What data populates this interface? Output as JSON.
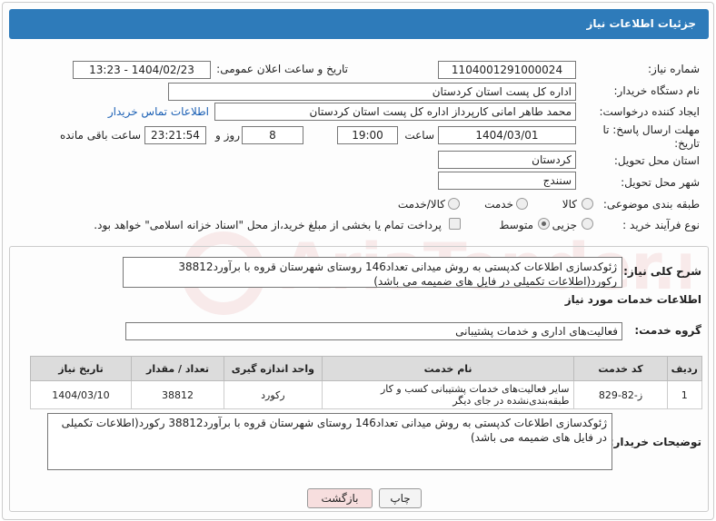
{
  "header": {
    "title": "جزئیات اطلاعات نیاز"
  },
  "labels": {
    "need_number": "شماره نیاز:",
    "announce_datetime": "تاریخ و ساعت اعلان عمومی:",
    "buyer_org": "نام دستگاه خریدار:",
    "requester": "ایجاد کننده درخواست:",
    "contact_link": "اطلاعات تماس خریدار",
    "deadline": "مهلت ارسال پاسخ: تا تاریخ:",
    "hour": "ساعت",
    "day_and": "روز و",
    "remaining": "ساعت باقی مانده",
    "province": "استان محل تحویل:",
    "city": "شهر محل تحویل:",
    "category": "طبقه بندی موضوعی:",
    "process_type": "نوع فرآیند خرید :",
    "description": "شرح کلی نیاز:",
    "services_info": "اطلاعات خدمات مورد نیاز",
    "service_group": "گروه خدمت:",
    "buyer_notes": "توضیحات خریدار:"
  },
  "values": {
    "need_number": "1104001291000024",
    "announce_datetime": "1404/02/23 - 13:23",
    "buyer_org": "اداره کل پست استان کردستان",
    "requester": "محمد طاهر امانی کارپرداز اداره کل پست استان کردستان",
    "deadline_date": "1404/03/01",
    "deadline_hour": "19:00",
    "days": "8",
    "remaining_time": "23:21:54",
    "province": "کردستان",
    "city": "سنندج",
    "description": "ژئوکدسازی اطلاعات کدپستی به روش میدانی تعداد146 روستای شهرستان قروه با برآورد38812 رکورد(اطلاعات تکمیلی در فایل های ضمیمه می باشد)",
    "service_group": "فعالیت‌های اداری و خدمات پشتیبانی",
    "buyer_notes": "ژئوکدسازی اطلاعات کدپستی به روش میدانی تعداد146 روستای شهرستان قروه با برآورد38812   رکورد(اطلاعات تکمیلی در فایل های ضمیمه می باشد)"
  },
  "category_options": [
    {
      "label": "کالا",
      "selected": false
    },
    {
      "label": "خدمت",
      "selected": false
    },
    {
      "label": "کالا/خدمت",
      "selected": false
    }
  ],
  "process_options": [
    {
      "label": "جزیی",
      "selected": false
    },
    {
      "label": "متوسط",
      "selected": true
    }
  ],
  "payment_note": "پرداخت تمام یا بخشی از مبلغ خرید،از محل \"اسناد خزانه اسلامی\" خواهد بود.",
  "table": {
    "headers": [
      "ردیف",
      "کد خدمت",
      "نام خدمت",
      "واحد اندازه گیری",
      "تعداد / مقدار",
      "تاریخ نیاز"
    ],
    "rows": [
      [
        "1",
        "ز-82-829",
        "سایر فعالیت‌های خدمات پشتیبانی کسب و کار طبقه‌بندی‌نشده در جای دیگر",
        "رکورد",
        "38812",
        "1404/03/10"
      ]
    ]
  },
  "buttons": {
    "print": "چاپ",
    "back": "بازگشت"
  },
  "watermark": "AriaTender.neT",
  "colors": {
    "header": "#2e7bba",
    "link": "#1a5fb4",
    "back_button": "#f7dede"
  }
}
